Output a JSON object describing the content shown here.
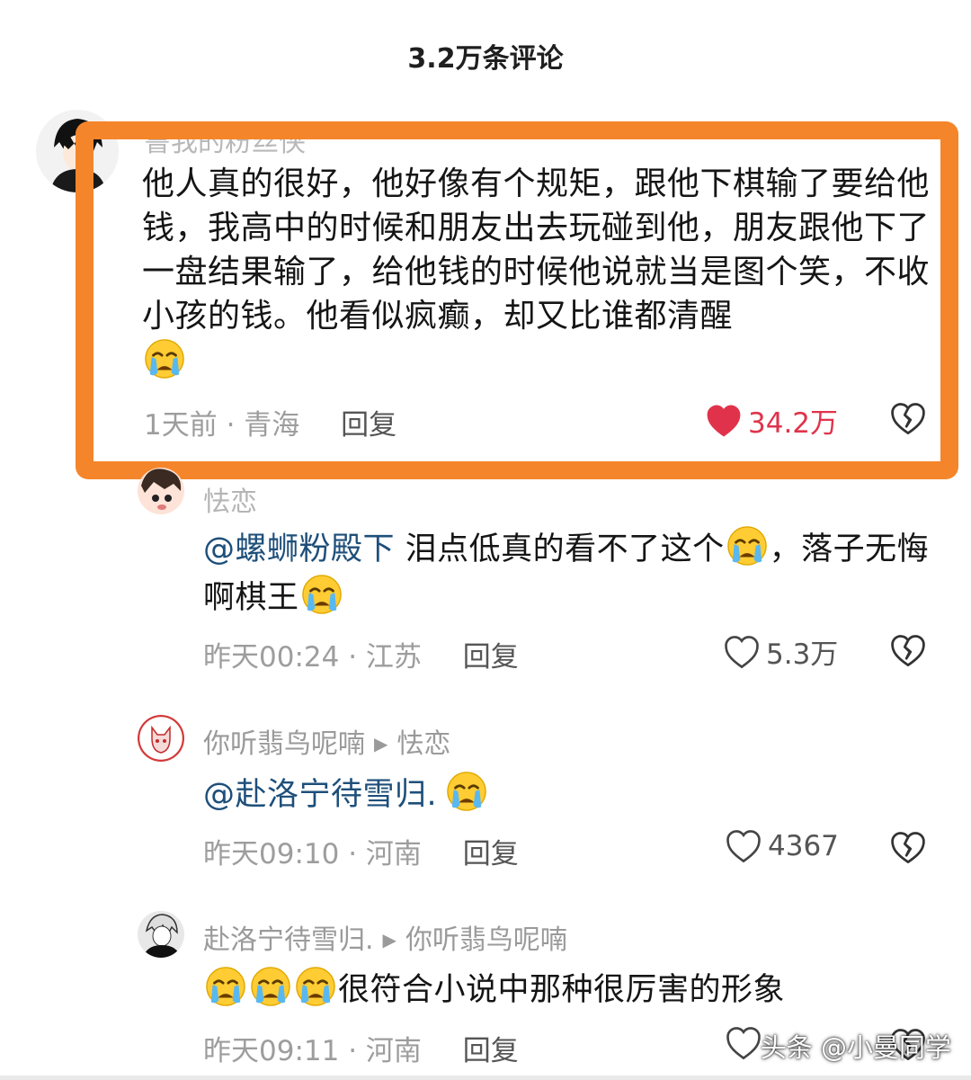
{
  "header": {
    "title": "3.2万条评论"
  },
  "comments": [
    {
      "username": "鲁我的粉丝侠",
      "text": "他人真的很好，他好像有个规矩，跟他下棋输了要给他钱，我高中的时候和朋友出去玩碰到他，朋友跟他下了一盘结果输了，给他钱的时候他说就当是图个笑，不收小孩的钱。他看似疯癫，却又比谁都清醒",
      "time_location": "1天前 · 青海",
      "reply_label": "回复",
      "likes": "34.2万",
      "liked": true
    },
    {
      "username": "怯恋",
      "mention": "@螺蛳粉殿下",
      "text_part1": " 泪点低真的看不了这个",
      "text_part2": "，落子无悔啊棋王",
      "time_location": "昨天00:24 · 江苏",
      "reply_label": "回复",
      "likes": "5.3万"
    },
    {
      "username": "你听翡鸟呢喃",
      "reply_to": "怯恋",
      "mention": "@赴洛宁待雪归.",
      "time_location": "昨天09:10 · 河南",
      "reply_label": "回复",
      "likes": "4367"
    },
    {
      "username": "赴洛宁待雪归.",
      "reply_to": "你听翡鸟呢喃",
      "text": "很符合小说中那种很厉害的形象",
      "time_location": "昨天09:11 · 河南",
      "reply_label": "回复"
    }
  ],
  "watermark": "头条 @小曼同学",
  "colors": {
    "highlight": "#f5852a",
    "liked": "#e0334b",
    "mention": "#1e4f7a"
  },
  "icons": [
    "crying-emoji-icon",
    "heart-icon",
    "broken-heart-icon",
    "triangle-arrow-icon"
  ]
}
